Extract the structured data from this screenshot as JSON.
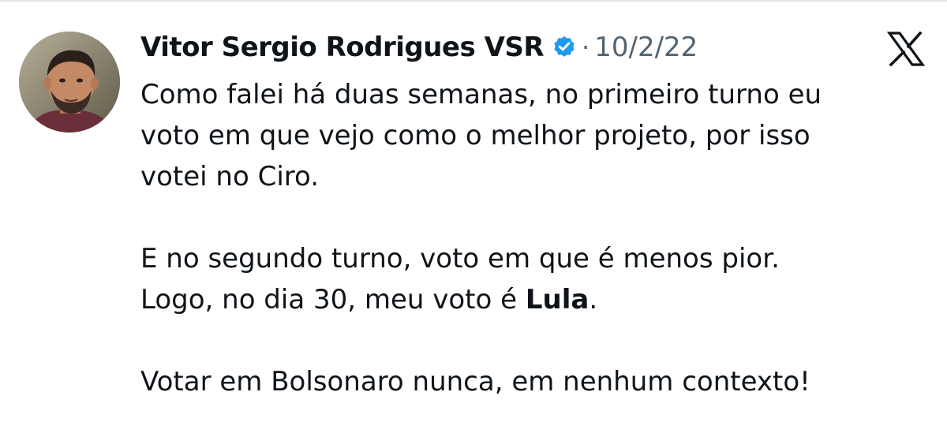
{
  "author": {
    "display_name": "Vitor Sergio Rodrigues VSR",
    "verified_icon": "verified-badge-icon",
    "verified_color": "#1d9bf0"
  },
  "separator": "·",
  "date": "10/2/22",
  "platform_icon": "x-logo-icon",
  "tweet": {
    "paragraph1": [
      "Como falei há duas semanas, no primeiro turno eu",
      "voto em que vejo como o melhor projeto, por isso",
      "votei no Ciro."
    ],
    "paragraph2": [
      "E no segundo turno, voto em que é menos pior."
    ],
    "paragraph2_line2_prefix": "Logo, no dia 30, meu voto é ",
    "paragraph2_line2_bold": "Lula",
    "paragraph2_line2_suffix": ".",
    "paragraph3": [
      "Votar em Bolsonaro nunca, em nenhum contexto!"
    ]
  },
  "colors": {
    "text": "#0f1419",
    "secondary_text": "#536471",
    "background": "#ffffff"
  }
}
